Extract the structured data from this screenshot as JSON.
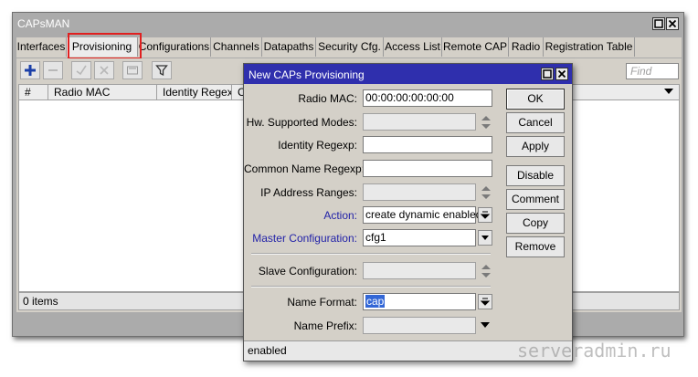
{
  "window": {
    "title": "CAPsMAN",
    "tabs": [
      {
        "label": "Interfaces",
        "active": false
      },
      {
        "label": "Provisioning",
        "active": true
      },
      {
        "label": "Configurations",
        "active": false
      },
      {
        "label": "Channels",
        "active": false
      },
      {
        "label": "Datapaths",
        "active": false
      },
      {
        "label": "Security Cfg.",
        "active": false
      },
      {
        "label": "Access List",
        "active": false
      },
      {
        "label": "Remote CAP",
        "active": false
      },
      {
        "label": "Radio",
        "active": false
      },
      {
        "label": "Registration Table",
        "active": false
      }
    ],
    "toolbar": {
      "add_icon": "plus-icon",
      "remove_icon": "minus-icon",
      "enable_icon": "check-icon",
      "disable_icon": "x-icon",
      "comment_icon": "comment-icon",
      "filter_icon": "filter-icon",
      "find_placeholder": "Find"
    },
    "columns": [
      "#",
      "Radio MAC",
      "Identity Regexp",
      "Co"
    ],
    "status": "0 items",
    "highlight_color": "#e02020"
  },
  "dialog": {
    "title": "New CAPs Provisioning",
    "fields": {
      "radio_mac": {
        "label": "Radio MAC:",
        "value": "00:00:00:00:00:00"
      },
      "hw_modes": {
        "label": "Hw. Supported Modes:",
        "value": ""
      },
      "identity_regexp": {
        "label": "Identity Regexp:",
        "value": ""
      },
      "common_name_regexp": {
        "label": "Common Name Regexp:",
        "value": ""
      },
      "ip_ranges": {
        "label": "IP Address Ranges:",
        "value": ""
      },
      "action": {
        "label": "Action:",
        "value": "create dynamic enabled"
      },
      "master_config": {
        "label": "Master Configuration:",
        "value": "cfg1"
      },
      "slave_config": {
        "label": "Slave Configuration:",
        "value": ""
      },
      "name_format": {
        "label": "Name Format:",
        "value": "cap"
      },
      "name_prefix": {
        "label": "Name Prefix:",
        "value": ""
      }
    },
    "buttons": {
      "ok": "OK",
      "cancel": "Cancel",
      "apply": "Apply",
      "disable": "Disable",
      "comment": "Comment",
      "copy": "Copy",
      "remove": "Remove"
    },
    "status": "enabled",
    "title_color": "#2f2fad",
    "link_label_color": "#2323a8"
  },
  "watermark": "serveradmin.ru"
}
